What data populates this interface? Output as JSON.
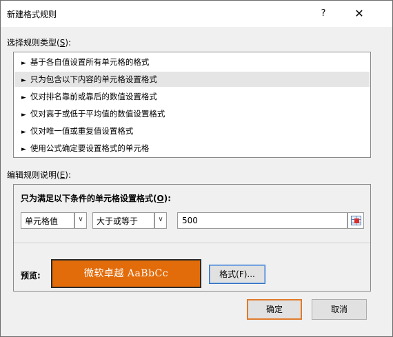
{
  "dialog": {
    "title": "新建格式规则",
    "help_label": "?",
    "close_label": "✕"
  },
  "rule_type": {
    "label_prefix": "选择规则类型(",
    "label_key": "S",
    "label_suffix": "):",
    "items": [
      {
        "label": "基于各自值设置所有单元格的格式",
        "selected": false
      },
      {
        "label": "只为包含以下内容的单元格设置格式",
        "selected": true
      },
      {
        "label": "仅对排名靠前或靠后的数值设置格式",
        "selected": false
      },
      {
        "label": "仅对高于或低于平均值的数值设置格式",
        "selected": false
      },
      {
        "label": "仅对唯一值或重复值设置格式",
        "selected": false
      },
      {
        "label": "使用公式确定要设置格式的单元格",
        "selected": false
      }
    ],
    "item_marker": "►"
  },
  "description": {
    "label_prefix": "编辑规则说明(",
    "label_key": "E",
    "label_suffix": "):",
    "condition_prefix": "只为满足以下条件的单元格设置格式(",
    "condition_key": "O",
    "condition_suffix": "):",
    "field1": "单元格值",
    "field2": "大于或等于",
    "value": "500",
    "arrow_glyph": "∨"
  },
  "preview": {
    "label": "预览:",
    "sample": "微软卓越  AaBbCc",
    "format_button": "格式(F)...",
    "fill_color": "#e36c0a"
  },
  "buttons": {
    "ok": "确定",
    "cancel": "取消"
  },
  "colors": {
    "focus_orange": "#e07a2a",
    "focus_blue": "#2f6fc6"
  }
}
